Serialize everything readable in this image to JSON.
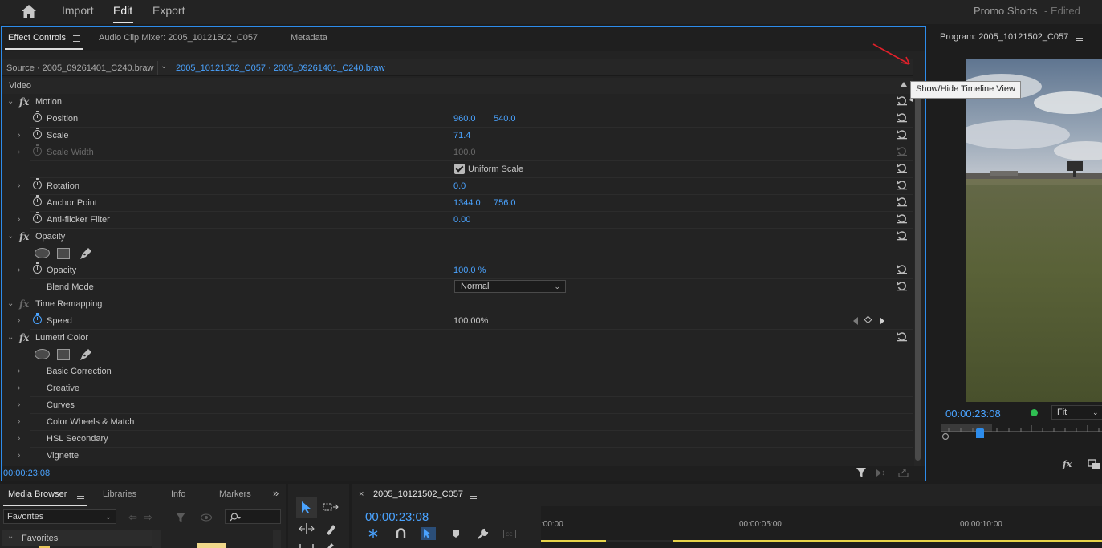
{
  "topbar": {
    "tabs": [
      "Import",
      "Edit",
      "Export"
    ],
    "project_name": "Promo Shorts",
    "project_status": "- Edited"
  },
  "effect_controls": {
    "tabs": [
      "Effect Controls",
      "Audio Clip Mixer: 2005_10121502_C057",
      "Metadata"
    ],
    "source_label": "Source · 2005_09261401_C240.braw",
    "sequence_label": "2005_10121502_C057 · 2005_09261401_C240.braw",
    "section_label": "Video",
    "rows": [
      {
        "name": "Motion"
      },
      {
        "name": "Position",
        "v1": "960.0",
        "v2": "540.0"
      },
      {
        "name": "Scale",
        "v1": "71.4"
      },
      {
        "name": "Scale Width",
        "v1": "100.0"
      },
      {
        "name": "Uniform Scale"
      },
      {
        "name": "Rotation",
        "v1": "0.0"
      },
      {
        "name": "Anchor Point",
        "v1": "1344.0",
        "v2": "756.0"
      },
      {
        "name": "Anti-flicker Filter",
        "v1": "0.00"
      },
      {
        "name": "Opacity"
      },
      {
        "name": "Opacity",
        "v1": "100.0 %"
      },
      {
        "name": "Blend Mode",
        "v1": "Normal"
      },
      {
        "name": "Time Remapping"
      },
      {
        "name": "Speed",
        "v1": "100.00%"
      },
      {
        "name": "Lumetri Color"
      },
      {
        "name": "Basic Correction"
      },
      {
        "name": "Creative"
      },
      {
        "name": "Curves"
      },
      {
        "name": "Color Wheels & Match"
      },
      {
        "name": "HSL Secondary"
      },
      {
        "name": "Vignette"
      }
    ],
    "timecode": "00:00:23:08",
    "tooltip": "Show/Hide Timeline View"
  },
  "program": {
    "title": "Program: 2005_10121502_C057",
    "timecode": "00:00:23:08",
    "fit": "Fit"
  },
  "bottom": {
    "left_tabs": [
      "Media Browser",
      "Libraries",
      "Info",
      "Markers"
    ],
    "favorites_select": "Favorites",
    "favorites_tree": "Favorites",
    "sequence_tab": "2005_10121502_C057",
    "timeline_timecode": "00:00:23:08",
    "ruler": [
      ":00:00",
      "00:00:05:00",
      "00:00:10:00"
    ]
  },
  "colors": {
    "accent": "#2d8ceb",
    "value_blue": "#4aa3ff",
    "annotation_red": "#e0202a",
    "record_green": "#2fbf52"
  }
}
